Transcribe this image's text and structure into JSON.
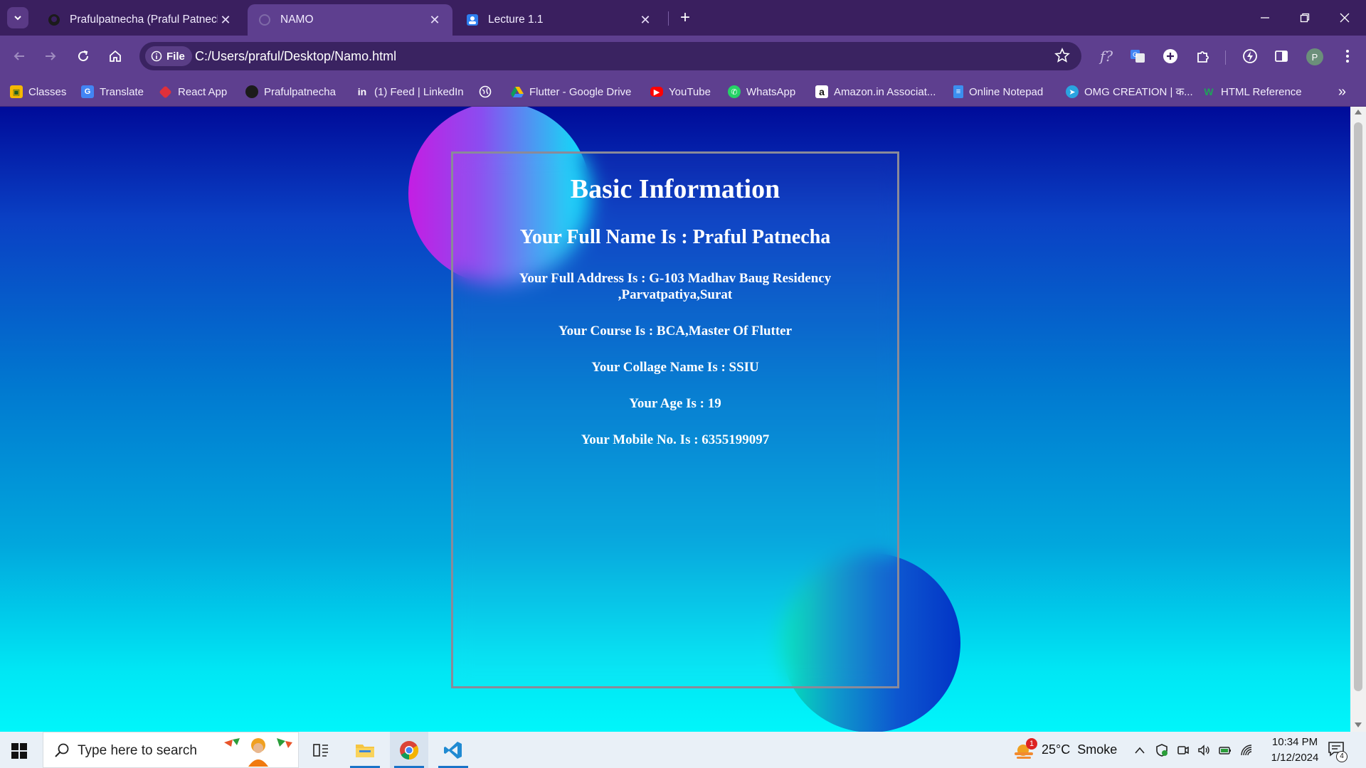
{
  "browser": {
    "tabs": [
      {
        "title": "Prafulpatnecha (Praful Patnecha"
      },
      {
        "title": "NAMO"
      },
      {
        "title": "Lecture 1.1"
      }
    ],
    "omnibox": {
      "scheme_chip": "File",
      "url": "C:/Users/praful/Desktop/Namo.html"
    },
    "profile_initial": "P",
    "bookmarks": [
      {
        "label": "Classes"
      },
      {
        "label": "Translate"
      },
      {
        "label": "React App"
      },
      {
        "label": "Prafulpatnecha"
      },
      {
        "label": "(1) Feed | LinkedIn"
      },
      {
        "label": ""
      },
      {
        "label": "Flutter - Google Drive"
      },
      {
        "label": "YouTube"
      },
      {
        "label": "WhatsApp"
      },
      {
        "label": "Amazon.in Associat..."
      },
      {
        "label": "Online Notepad"
      },
      {
        "label": "OMG CREATION | क..."
      },
      {
        "label": "HTML Reference"
      }
    ]
  },
  "page": {
    "title": "Basic Information",
    "name_line": "Your Full Name Is : Praful Patnecha",
    "address_line_1": "Your Full Address Is : G-103 Madhav Baug Residency",
    "address_line_2": ",Parvatpatiya,Surat",
    "course_line": "Your Course Is : BCA,Master Of Flutter",
    "college_line": "Your Collage Name Is : SSIU",
    "age_line": "Your Age Is : 19",
    "mobile_line": "Your Mobile No. Is : 6355199097"
  },
  "taskbar": {
    "search_placeholder": "Type here to search",
    "weather": "25°C  Smoke",
    "weather_badge": "1",
    "time": "10:34 PM",
    "date": "1/12/2024",
    "notification_count": "4"
  },
  "colors": {
    "tabstrip": "#3a1f5f",
    "toolbar": "#5e3f8f",
    "page_gradient_top": "#000b99",
    "page_gradient_bottom": "#00f6fb"
  }
}
